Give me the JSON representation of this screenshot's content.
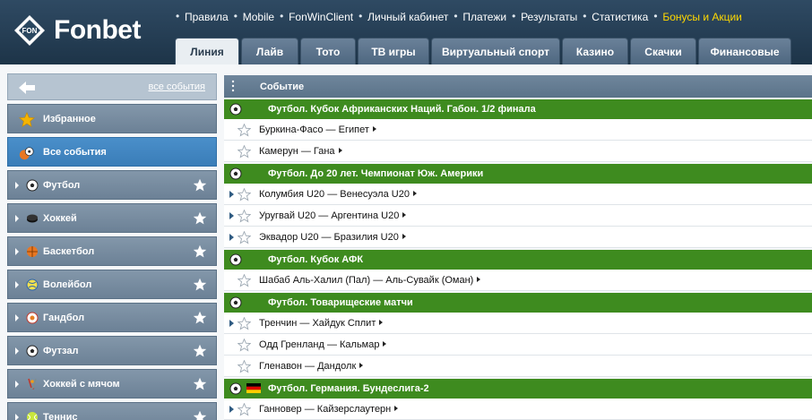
{
  "header": {
    "brand": "Fonbet",
    "brand_badge": "FON",
    "nav": [
      "Правила",
      "Mobile",
      "FonWinClient",
      "Личный кабинет",
      "Платежи",
      "Результаты",
      "Статистика",
      "Бонусы и Акции"
    ],
    "tabs": [
      "Линия",
      "Лайв",
      "Тото",
      "ТВ игры",
      "Виртуальный спорт",
      "Казино",
      "Скачки",
      "Финансовые"
    ]
  },
  "sidebar": {
    "all_events_link": "все события",
    "items": [
      {
        "label": "Избранное",
        "icon": "star-icon"
      },
      {
        "label": "Все события",
        "icon": "sports-balls-icon"
      },
      {
        "label": "Футбол",
        "icon": "football-icon"
      },
      {
        "label": "Хоккей",
        "icon": "hockey-puck-icon"
      },
      {
        "label": "Баскетбол",
        "icon": "basketball-icon"
      },
      {
        "label": "Волейбол",
        "icon": "volleyball-icon"
      },
      {
        "label": "Гандбол",
        "icon": "handball-icon"
      },
      {
        "label": "Футзал",
        "icon": "futsal-icon"
      },
      {
        "label": "Хоккей с мячом",
        "icon": "bandy-icon"
      },
      {
        "label": "Теннис",
        "icon": "tennis-icon"
      }
    ]
  },
  "main": {
    "header_title": "Событие",
    "leagues": [
      {
        "title": "Футбол. Кубок Африканских Наций. Габон. 1/2 финала",
        "events": [
          "Буркина-Фасо — Египет",
          "Камерун — Гана"
        ]
      },
      {
        "title": "Футбол. До 20 лет. Чемпионат Юж. Америки",
        "events": [
          "Колумбия U20 — Венесуэла U20",
          "Уругвай U20 — Аргентина U20",
          "Эквадор U20 — Бразилия U20"
        ]
      },
      {
        "title": "Футбол. Кубок АФК",
        "events": [
          "Шабаб Аль-Халил (Пал) — Аль-Сувайк (Оман)"
        ]
      },
      {
        "title": "Футбол. Товарищеские матчи",
        "events": [
          "Тренчин — Хайдук Сплит",
          "Одд Гренланд — Кальмар",
          "Гленавон — Дандолк"
        ]
      },
      {
        "title": "Футбол. Германия. Бундеслига-2",
        "events": [
          "Ганновер — Кайзерслаутерн"
        ]
      }
    ]
  },
  "colors": {
    "league_bar": "#3e8b1f",
    "sidebar_active": "#3a7db8",
    "bonus_link": "#ffd800"
  }
}
